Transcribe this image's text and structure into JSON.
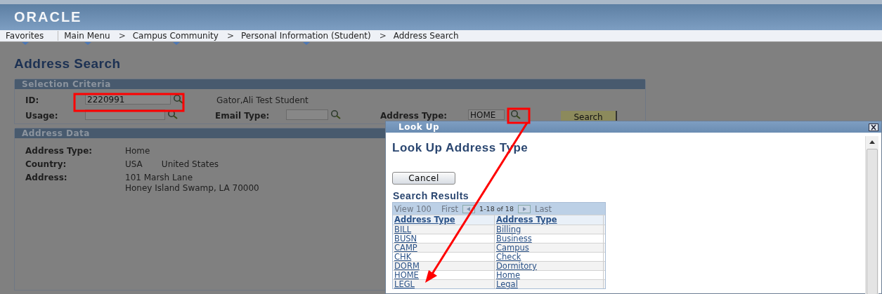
{
  "header": {
    "logo": "ORACLE"
  },
  "nav": [
    {
      "label": "Favorites",
      "kind": "menu"
    },
    {
      "label": "Main Menu",
      "kind": "menu"
    },
    {
      "label": ">",
      "kind": "separator"
    },
    {
      "label": "Campus Community",
      "kind": "menu"
    },
    {
      "label": ">",
      "kind": "separator"
    },
    {
      "label": "Personal Information (Student)",
      "kind": "menu"
    },
    {
      "label": ">",
      "kind": "separator"
    },
    {
      "label": "Address Search",
      "kind": "current"
    }
  ],
  "page_title": "Address Search",
  "selection_criteria": {
    "title": "Selection Criteria",
    "id_label": "ID:",
    "id_value": "2220991",
    "name": "Gator,Ali Test Student",
    "usage_label": "Usage:",
    "email_type_label": "Email Type:",
    "address_type_label": "Address Type:",
    "address_type_value": "HOME",
    "search_button": "Search"
  },
  "address_data": {
    "title": "Address Data",
    "rows": [
      {
        "label": "Address Type:",
        "values": [
          "Home"
        ]
      },
      {
        "label": "Country:",
        "values": [
          "USA",
          "United States"
        ]
      },
      {
        "label": "Address:",
        "values": [
          "101 Marsh Lane",
          "Honey Island Swamp, LA 70000"
        ]
      }
    ]
  },
  "lookup": {
    "window_title": "Look Up",
    "title": "Look Up Address Type",
    "cancel_button": "Cancel",
    "results_title": "Search Results",
    "view_all": "View 100",
    "first": "First",
    "range": "1-18 of 18",
    "last": "Last",
    "columns": [
      "Address Type",
      "Address Type"
    ],
    "rows": [
      [
        "BILL",
        "Billing"
      ],
      [
        "BUSN",
        "Business"
      ],
      [
        "CAMP",
        "Campus"
      ],
      [
        "CHK",
        "Check"
      ],
      [
        "DORM",
        "Dormitory"
      ],
      [
        "HOME",
        "Home"
      ],
      [
        "LEGL",
        "Legal"
      ]
    ]
  }
}
